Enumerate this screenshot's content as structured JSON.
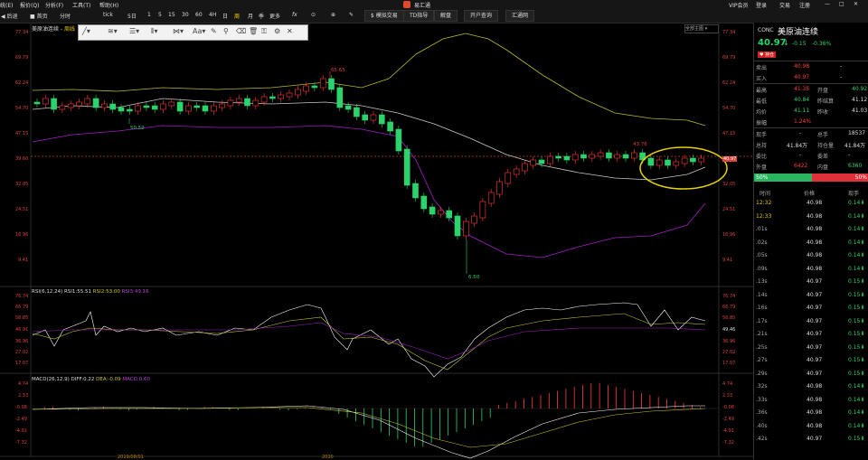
{
  "menubar": {
    "items": [
      "统(E)",
      "报价(Q)",
      "分析(F)",
      "工具(T)",
      "帮助(H)"
    ],
    "app_title": "易汇通",
    "right_items": [
      "VIP会员",
      "登录",
      "交易",
      "注册"
    ]
  },
  "toolbar": {
    "back": "后退",
    "home": "首页",
    "items": [
      "分时",
      "tick",
      "5日",
      "1",
      "5",
      "15",
      "30",
      "60",
      "4H",
      "日",
      "周",
      "月",
      "季",
      "更多"
    ],
    "fx": "fx",
    "buttons": [
      "模拟交易",
      "TD指导",
      "解盘",
      "开户查询",
      "汇通网"
    ]
  },
  "chart_header": {
    "title": "美原油连续",
    "subtitle": "周线",
    "suffix": "前复权"
  },
  "right_panel": {
    "code": "CONC",
    "name": "美原油连续",
    "price": "40.97",
    "change": "-0.15",
    "pct": "-0.36%",
    "badge_label": "持仓",
    "sell_label": "卖出",
    "sell_price": "40.98",
    "sell_vol": "-",
    "buy_label": "买入",
    "buy_price": "40.97",
    "buy_vol": "-",
    "high_label": "最高",
    "high": "41.35",
    "open_label": "开盘",
    "open": "40.92",
    "low_label": "最低",
    "low": "40.84",
    "settle_label": "昨结算",
    "settle": "41.12",
    "avg_label": "均价",
    "avg": "41.11",
    "prevclose_label": "昨收",
    "prevclose": "41.03",
    "amp_label": "振幅",
    "amp": "1.24%",
    "cur_label": "现手",
    "cur": "-",
    "total_label": "总手",
    "total": "18537",
    "oi_label": "总持",
    "oi": "41.84万",
    "oi2_label": "持仓量",
    "oi2": "41.84万",
    "ratio_label": "委比",
    "ratio": "-",
    "diff_label": "委差",
    "diff": "-",
    "outer_label": "外盘",
    "outer": "6422",
    "inner_label": "内盘",
    "inner": "6360",
    "bar_left": "50%",
    "bar_right": "50%",
    "col_time": "时间",
    "col_price": "价格",
    "col_vol": "现手",
    "trades": [
      {
        "t": "12:32",
        "p": "40.98",
        "v": "0.14"
      },
      {
        "t": "12:33",
        "p": "40.98",
        "v": "0.14"
      },
      {
        "t": ".01s",
        "p": "40.98",
        "v": "0.14"
      },
      {
        "t": ".02s",
        "p": "40.98",
        "v": "0.14"
      },
      {
        "t": ".05s",
        "p": "40.98",
        "v": "0.14"
      },
      {
        "t": ".09s",
        "p": "40.98",
        "v": "0.14"
      },
      {
        "t": ".13s",
        "p": "40.97",
        "v": "0.15"
      },
      {
        "t": ".14s",
        "p": "40.97",
        "v": "0.15"
      },
      {
        "t": ".16s",
        "p": "40.97",
        "v": "0.15"
      },
      {
        "t": ".17s",
        "p": "40.97",
        "v": "0.15"
      },
      {
        "t": ".21s",
        "p": "40.97",
        "v": "0.15"
      },
      {
        "t": ".25s",
        "p": "40.97",
        "v": "0.15"
      },
      {
        "t": ".27s",
        "p": "40.97",
        "v": "0.15"
      },
      {
        "t": ".29s",
        "p": "40.97",
        "v": "0.15"
      },
      {
        "t": ".32s",
        "p": "40.98",
        "v": "0.14"
      },
      {
        "t": ".33s",
        "p": "40.98",
        "v": "0.14"
      },
      {
        "t": ".36s",
        "p": "40.98",
        "v": "0.14"
      },
      {
        "t": ".40s",
        "p": "40.98",
        "v": "0.14"
      },
      {
        "t": ".42s",
        "p": "40.97",
        "v": "0.15"
      }
    ]
  },
  "main_axis": {
    "ticks": [
      "77.34",
      "69.79",
      "62.24",
      "54.70",
      "47.15",
      "39.60",
      "32.05",
      "24.51",
      "16.96",
      "9.41"
    ],
    "right_current": "40.97",
    "high_mark": "65.65",
    "low_mark": "6.50",
    "mark_4376": "43.76",
    "mark_5052": "50.52"
  },
  "rsi": {
    "title": "RSI(6,12,24)",
    "v1_label": "RSI1:55.51",
    "v2_label": "RSI2:53.00",
    "v3_label": "RSI3:49.16",
    "ticks": [
      "76.74",
      "66.79",
      "56.85",
      "46.91",
      "36.96",
      "27.02",
      "17.07"
    ],
    "right_value": "49.46"
  },
  "macd": {
    "title": "MACD(26,12,9)",
    "diff_label": "DIFF:0.22",
    "dea_label": "DEA:-0.09",
    "macd_label": "MACD:0.60",
    "ticks": [
      "4.74",
      "2.33",
      "-0.08",
      "-2.49",
      "-4.91",
      "-7.32"
    ],
    "bottom_labels": [
      "2019/08/01",
      "2020"
    ]
  },
  "dropdown": {
    "label": "全部主图"
  },
  "colors": {
    "up": "#ff3c3c",
    "down": "#2bd46b",
    "boll_upper": "#b8b82a",
    "boll_mid": "#c8c8c8",
    "boll_lower": "#a020c0",
    "annotation": "#e6d200"
  }
}
